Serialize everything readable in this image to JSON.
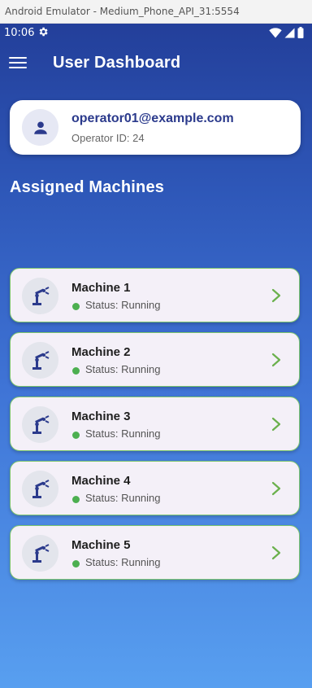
{
  "window": {
    "title": "Android Emulator - Medium_Phone_API_31:5554"
  },
  "status_bar": {
    "time": "10:06",
    "icons": [
      "gear-icon",
      "wifi-icon",
      "signal-icon",
      "battery-icon"
    ]
  },
  "app_bar": {
    "title": "User Dashboard",
    "menu_icon": "menu-icon"
  },
  "profile": {
    "email": "operator01@example.com",
    "operator_id": "Operator ID: 24",
    "avatar_icon": "person-icon"
  },
  "section": {
    "title": "Assigned Machines"
  },
  "machines": [
    {
      "name": "Machine 1",
      "status": "Status: Running"
    },
    {
      "name": "Machine 2",
      "status": "Status: Running"
    },
    {
      "name": "Machine 3",
      "status": "Status: Running"
    },
    {
      "name": "Machine 4",
      "status": "Status: Running"
    },
    {
      "name": "Machine 5",
      "status": "Status: Running"
    }
  ],
  "colors": {
    "accent": "#2b3a8c",
    "status_running": "#4caf50",
    "card_border": "#7bc46d",
    "chevron": "#6ab04c"
  }
}
